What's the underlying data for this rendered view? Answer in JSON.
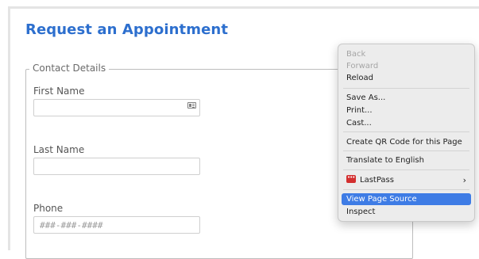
{
  "page": {
    "title": "Request an Appointment"
  },
  "contact": {
    "legend": "Contact Details",
    "first_name_label": "First Name",
    "first_name_value": "",
    "last_name_label": "Last Name",
    "last_name_value": "",
    "phone_label": "Phone",
    "phone_placeholder": "###-###-####"
  },
  "context_menu": {
    "back": "Back",
    "forward": "Forward",
    "reload": "Reload",
    "save_as": "Save As...",
    "print": "Print...",
    "cast": "Cast...",
    "qr_code": "Create QR Code for this Page",
    "translate": "Translate to English",
    "lastpass": "LastPass",
    "lastpass_chevron": "›",
    "view_source": "View Page Source",
    "inspect": "Inspect"
  },
  "icons": {
    "first_name_field": "contact-card-icon",
    "lastpass": "lastpass-icon",
    "submenu": "chevron-right-icon"
  },
  "colors": {
    "title": "#2d6fce",
    "highlight": "#3e7ce5",
    "lastpass": "#d32f2f"
  }
}
